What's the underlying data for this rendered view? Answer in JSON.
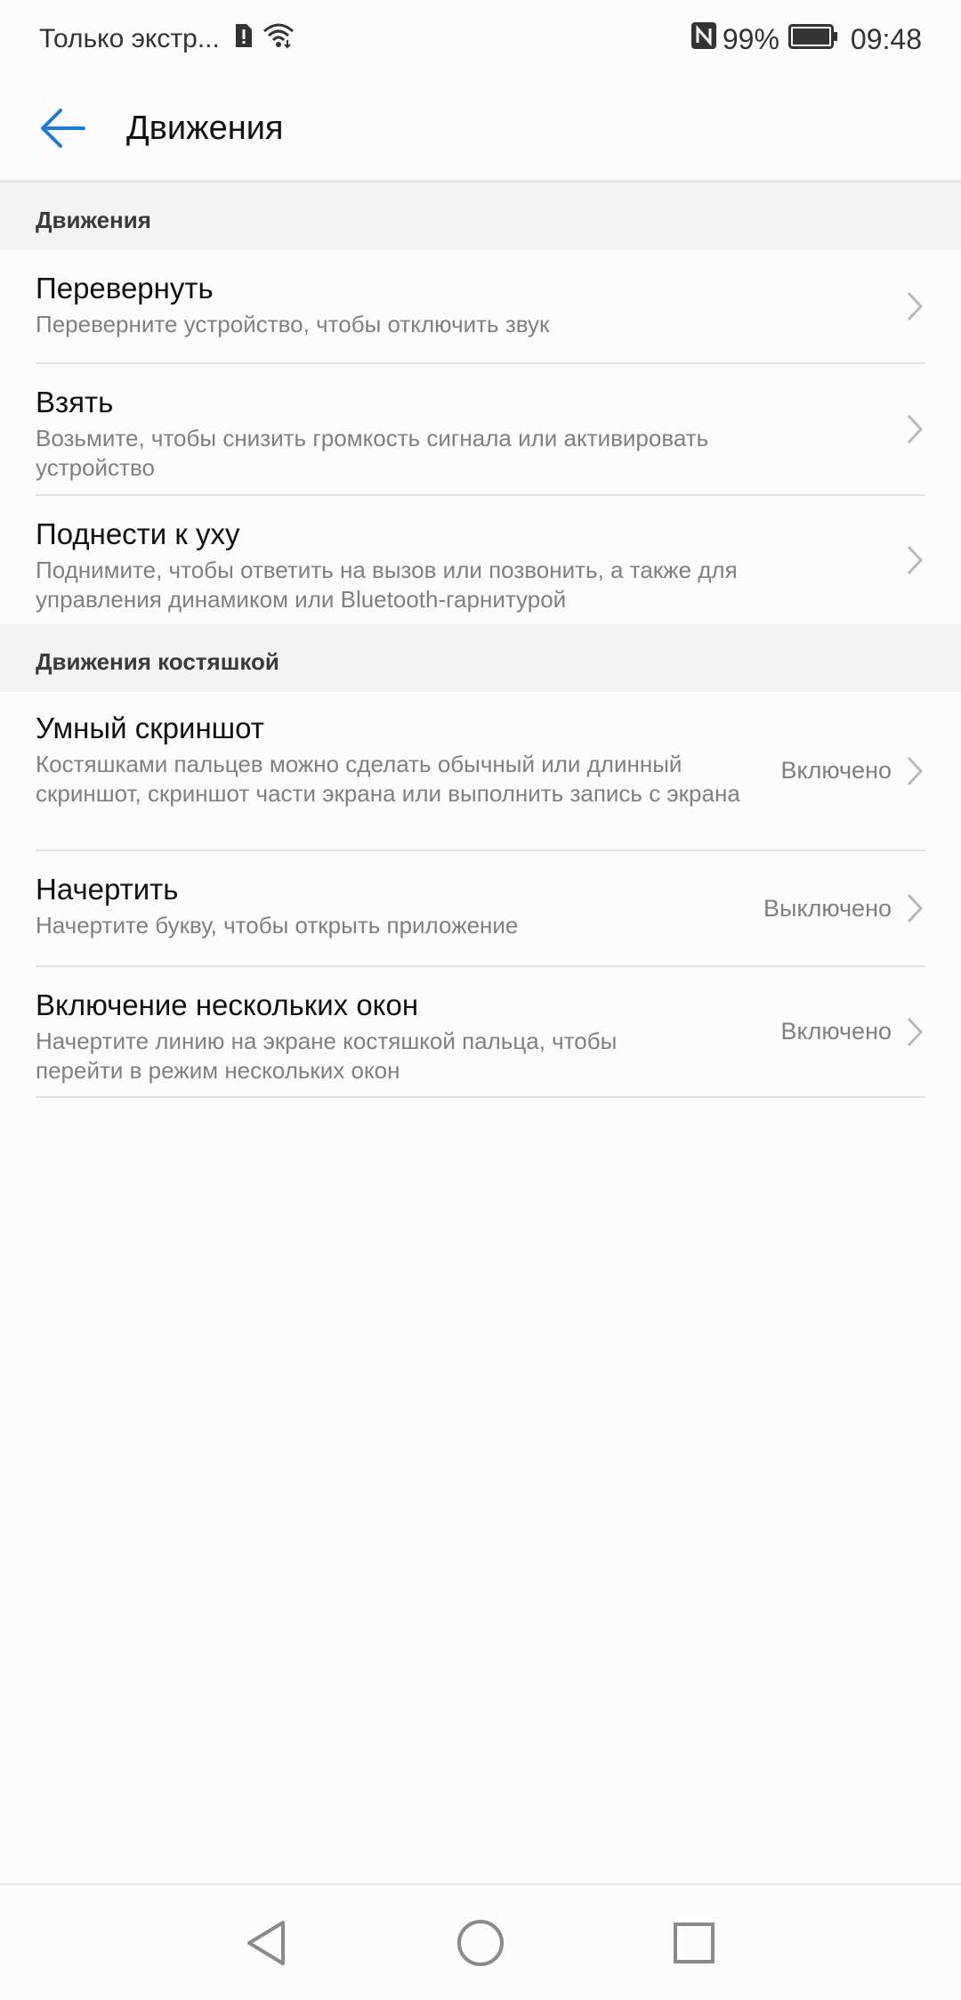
{
  "status_bar": {
    "carrier": "Только экстр...",
    "battery_percent": "99%",
    "time": "09:48"
  },
  "header": {
    "title": "Движения"
  },
  "sections": [
    {
      "header": "Движения",
      "items": [
        {
          "title": "Перевернуть",
          "description": "Переверните устройство, чтобы отключить звук",
          "status": ""
        },
        {
          "title": "Взять",
          "description": "Возьмите, чтобы снизить громкость сигнала или активировать устройство",
          "status": ""
        },
        {
          "title": "Поднести к уху",
          "description": "Поднимите, чтобы ответить на вызов или позвонить, а также для управления динамиком или Bluetooth-гарнитурой",
          "status": ""
        }
      ]
    },
    {
      "header": "Движения костяшкой",
      "items": [
        {
          "title": "Умный скриншот",
          "description": "Костяшками пальцев можно сделать обычный или длинный скриншот, скриншот части экрана или выполнить запись с экрана",
          "status": "Включено"
        },
        {
          "title": "Начертить",
          "description": "Начертите букву, чтобы открыть приложение",
          "status": "Выключено"
        },
        {
          "title": "Включение нескольких окон",
          "description": "Начертите линию на экране костяшкой пальца, чтобы перейти в режим нескольких окон",
          "status": "Включено"
        }
      ]
    }
  ],
  "colors": {
    "accent": "#1f7ad8",
    "title_text": "#111111",
    "secondary_text": "#808080",
    "section_bg": "#f3f3f3",
    "divider": "#e3e3e3"
  },
  "icons": {
    "back": "arrow-left-icon",
    "chevron": "chevron-right-icon",
    "nav_back": "triangle-back-icon",
    "nav_home": "circle-home-icon",
    "nav_recent": "square-recent-icon"
  }
}
